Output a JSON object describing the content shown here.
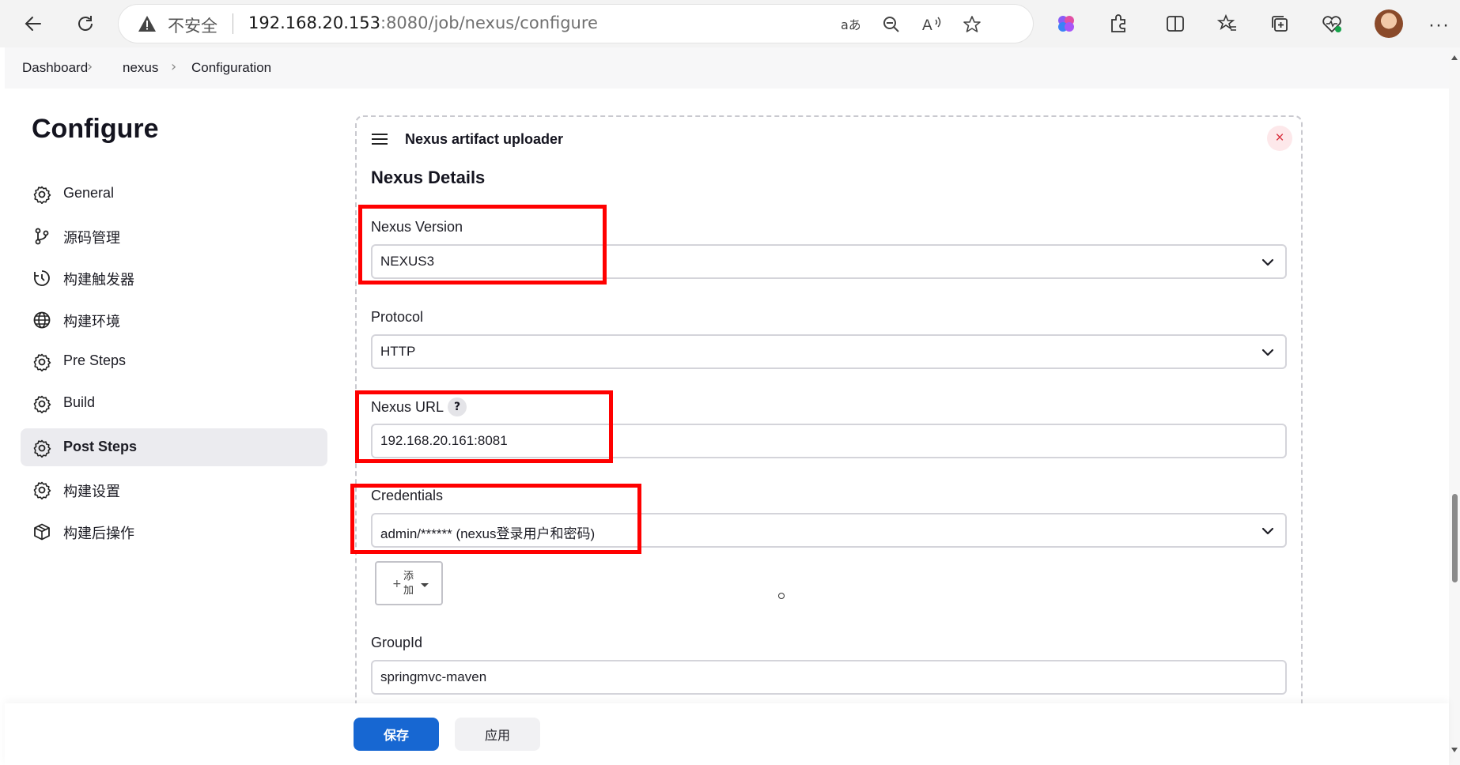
{
  "browser": {
    "insecure_label": "不安全",
    "url_main": "192.168.20.153",
    "url_rest": ":8080/job/nexus/configure",
    "more_label": "···"
  },
  "breadcrumb": {
    "items": [
      "Dashboard",
      "nexus",
      "Configuration"
    ],
    "separator": "›"
  },
  "page": {
    "title": "Configure"
  },
  "sidebar": {
    "items": [
      {
        "label": "General",
        "icon": "gear-icon"
      },
      {
        "label": "源码管理",
        "icon": "branch-icon"
      },
      {
        "label": "构建触发器",
        "icon": "clock-icon"
      },
      {
        "label": "构建环境",
        "icon": "globe-icon"
      },
      {
        "label": "Pre Steps",
        "icon": "gear-icon"
      },
      {
        "label": "Build",
        "icon": "gear-icon"
      },
      {
        "label": "Post Steps",
        "icon": "gear-icon",
        "active": true
      },
      {
        "label": "构建设置",
        "icon": "gear-icon"
      },
      {
        "label": "构建后操作",
        "icon": "package-icon"
      }
    ]
  },
  "card": {
    "title": "Nexus artifact uploader",
    "close_label": "×",
    "section_title": "Nexus Details",
    "fields": {
      "nexus_version": {
        "label": "Nexus Version",
        "value": "NEXUS3"
      },
      "protocol": {
        "label": "Protocol",
        "value": "HTTP"
      },
      "nexus_url": {
        "label": "Nexus URL",
        "value": "192.168.20.161:8081",
        "help": "?"
      },
      "credentials": {
        "label": "Credentials",
        "value": "admin/****** (nexus登录用户和密码)"
      },
      "group_id": {
        "label": "GroupId",
        "value": "springmvc-maven"
      }
    },
    "add_button": {
      "plus": "+",
      "label": "添加"
    }
  },
  "actions": {
    "save_label": "保存",
    "apply_label": "应用"
  },
  "colors": {
    "primary": "#1767d2",
    "highlight": "#ff0000",
    "active_nav_bg": "#ebebef"
  }
}
